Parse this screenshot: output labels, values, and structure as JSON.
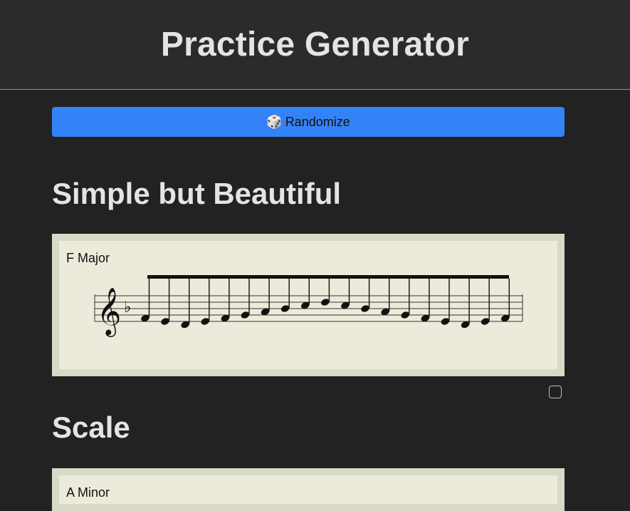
{
  "header": {
    "title": "Practice Generator"
  },
  "randomize": {
    "icon": "dice-icon",
    "icon_glyph": "🎲",
    "label": "Randomize"
  },
  "exercises": [
    {
      "title": "Simple but Beautiful",
      "key_label": "F Major",
      "clef": "treble",
      "key_signature": "F major (1 flat)",
      "notes": [
        "F4",
        "E4",
        "D4",
        "E4",
        "F4",
        "G4",
        "A4",
        "B♭4",
        "C5",
        "D5",
        "C5",
        "B♭4",
        "A4",
        "G4",
        "F4",
        "E4",
        "D4",
        "E4",
        "F4"
      ],
      "selected": false
    },
    {
      "title": "Scale",
      "key_label": "A Minor"
    }
  ]
}
